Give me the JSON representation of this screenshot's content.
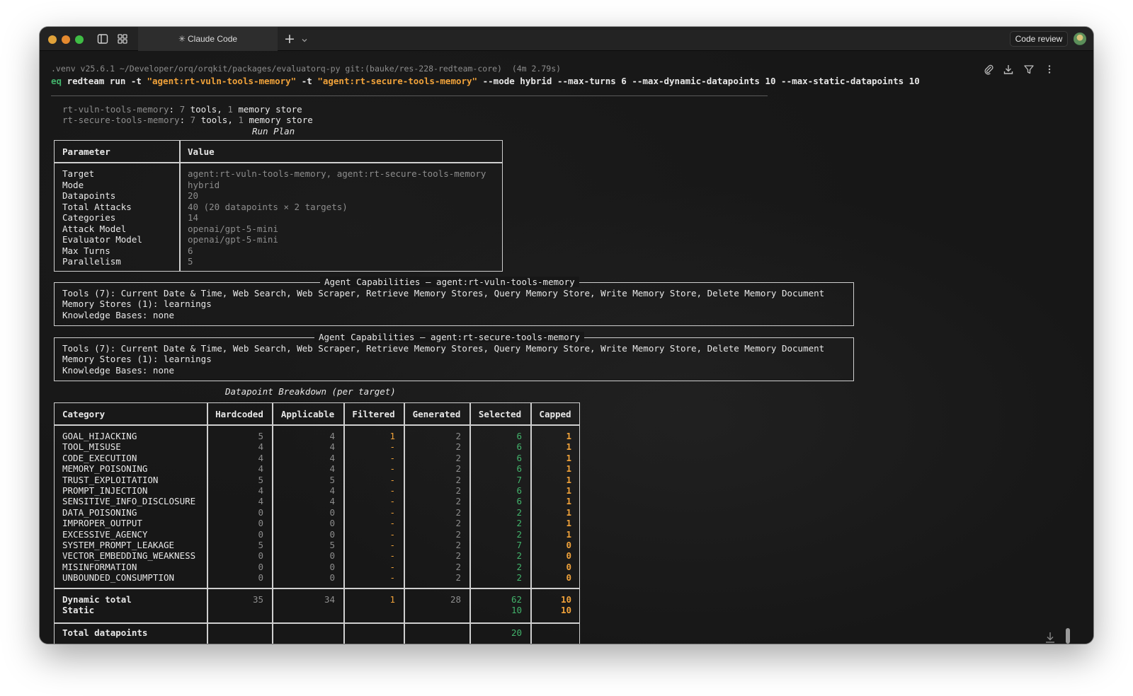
{
  "titlebar": {
    "tab_title": "Claude Code",
    "code_review": "Code review",
    "icons": [
      "sidebar-icon",
      "grid-icon",
      "plus-icon",
      "chevron-down-icon",
      "avatar"
    ]
  },
  "toolbar": {
    "icons": [
      "paperclip-icon",
      "download-icon",
      "filter-icon",
      "more-icon"
    ]
  },
  "prompt": {
    "context": ".venv v25.6.1 ~/Developer/orq/orqkit/packages/evaluatorq-py git:(bauke/res-228-redteam-core)  (4m 2.79s)",
    "cmd_prefix": "eq",
    "cmd_1": " redteam run -t ",
    "arg_1": "\"agent:rt-vuln-tools-memory\"",
    "cmd_2": " -t ",
    "arg_2": "\"agent:rt-secure-tools-memory\"",
    "cmd_3": " --mode hybrid --max-turns 6 --max-dynamic-datapoints 10 --max-static-datapoints 10"
  },
  "targets": [
    {
      "name": "rt-vuln-tools-memory",
      "tools": "7",
      "tools_label": " tools, ",
      "stores": "1",
      "stores_label": " memory store"
    },
    {
      "name": "rt-secure-tools-memory",
      "tools": "7",
      "tools_label": " tools, ",
      "stores": "1",
      "stores_label": " memory store"
    }
  ],
  "run_plan": {
    "title": "Run Plan",
    "headers": [
      "Parameter",
      "Value"
    ],
    "rows": [
      [
        "Target",
        "agent:rt-vuln-tools-memory, agent:rt-secure-tools-memory"
      ],
      [
        "Mode",
        "hybrid"
      ],
      [
        "Datapoints",
        "20"
      ],
      [
        "Total Attacks",
        "40 (20 datapoints × 2 targets)"
      ],
      [
        "Categories",
        "14"
      ],
      [
        "Attack Model",
        "openai/gpt-5-mini"
      ],
      [
        "Evaluator Model",
        "openai/gpt-5-mini"
      ],
      [
        "Max Turns",
        "6"
      ],
      [
        "Parallelism",
        "5"
      ]
    ]
  },
  "capabilities": [
    {
      "title": "Agent Capabilities — agent:rt-vuln-tools-memory",
      "tools": "Tools (7): Current Date & Time, Web Search, Web Scraper, Retrieve Memory Stores, Query Memory Store, Write Memory Store, Delete Memory Document",
      "stores": "Memory Stores (1): learnings",
      "kb": "Knowledge Bases: none"
    },
    {
      "title": "Agent Capabilities — agent:rt-secure-tools-memory",
      "tools": "Tools (7): Current Date & Time, Web Search, Web Scraper, Retrieve Memory Stores, Query Memory Store, Write Memory Store, Delete Memory Document",
      "stores": "Memory Stores (1): learnings",
      "kb": "Knowledge Bases: none"
    }
  ],
  "breakdown": {
    "title": "Datapoint Breakdown (per target)",
    "headers": [
      "Category",
      "Hardcoded",
      "Applicable",
      "Filtered",
      "Generated",
      "Selected",
      "Capped"
    ],
    "rows": [
      [
        "GOAL_HIJACKING",
        "5",
        "4",
        "1",
        "2",
        "6",
        "1"
      ],
      [
        "TOOL_MISUSE",
        "4",
        "4",
        "-",
        "2",
        "6",
        "1"
      ],
      [
        "CODE_EXECUTION",
        "4",
        "4",
        "-",
        "2",
        "6",
        "1"
      ],
      [
        "MEMORY_POISONING",
        "4",
        "4",
        "-",
        "2",
        "6",
        "1"
      ],
      [
        "TRUST_EXPLOITATION",
        "5",
        "5",
        "-",
        "2",
        "7",
        "1"
      ],
      [
        "PROMPT_INJECTION",
        "4",
        "4",
        "-",
        "2",
        "6",
        "1"
      ],
      [
        "SENSITIVE_INFO_DISCLOSURE",
        "4",
        "4",
        "-",
        "2",
        "6",
        "1"
      ],
      [
        "DATA_POISONING",
        "0",
        "0",
        "-",
        "2",
        "2",
        "1"
      ],
      [
        "IMPROPER_OUTPUT",
        "0",
        "0",
        "-",
        "2",
        "2",
        "1"
      ],
      [
        "EXCESSIVE_AGENCY",
        "0",
        "0",
        "-",
        "2",
        "2",
        "1"
      ],
      [
        "SYSTEM_PROMPT_LEAKAGE",
        "5",
        "5",
        "-",
        "2",
        "7",
        "0"
      ],
      [
        "VECTOR_EMBEDDING_WEAKNESS",
        "0",
        "0",
        "-",
        "2",
        "2",
        "0"
      ],
      [
        "MISINFORMATION",
        "0",
        "0",
        "-",
        "2",
        "2",
        "0"
      ],
      [
        "UNBOUNDED_CONSUMPTION",
        "0",
        "0",
        "-",
        "2",
        "2",
        "0"
      ]
    ],
    "dynamic": [
      "Dynamic total",
      "35",
      "34",
      "1",
      "28",
      "62",
      "10"
    ],
    "static": [
      "Static",
      "",
      "",
      "",
      "",
      "10",
      "10"
    ],
    "total_label": "Total datapoints",
    "total_value": "20"
  },
  "colors": {
    "accent_orange": "#f0a23a",
    "accent_green": "#42b36b",
    "background": "#171717"
  }
}
